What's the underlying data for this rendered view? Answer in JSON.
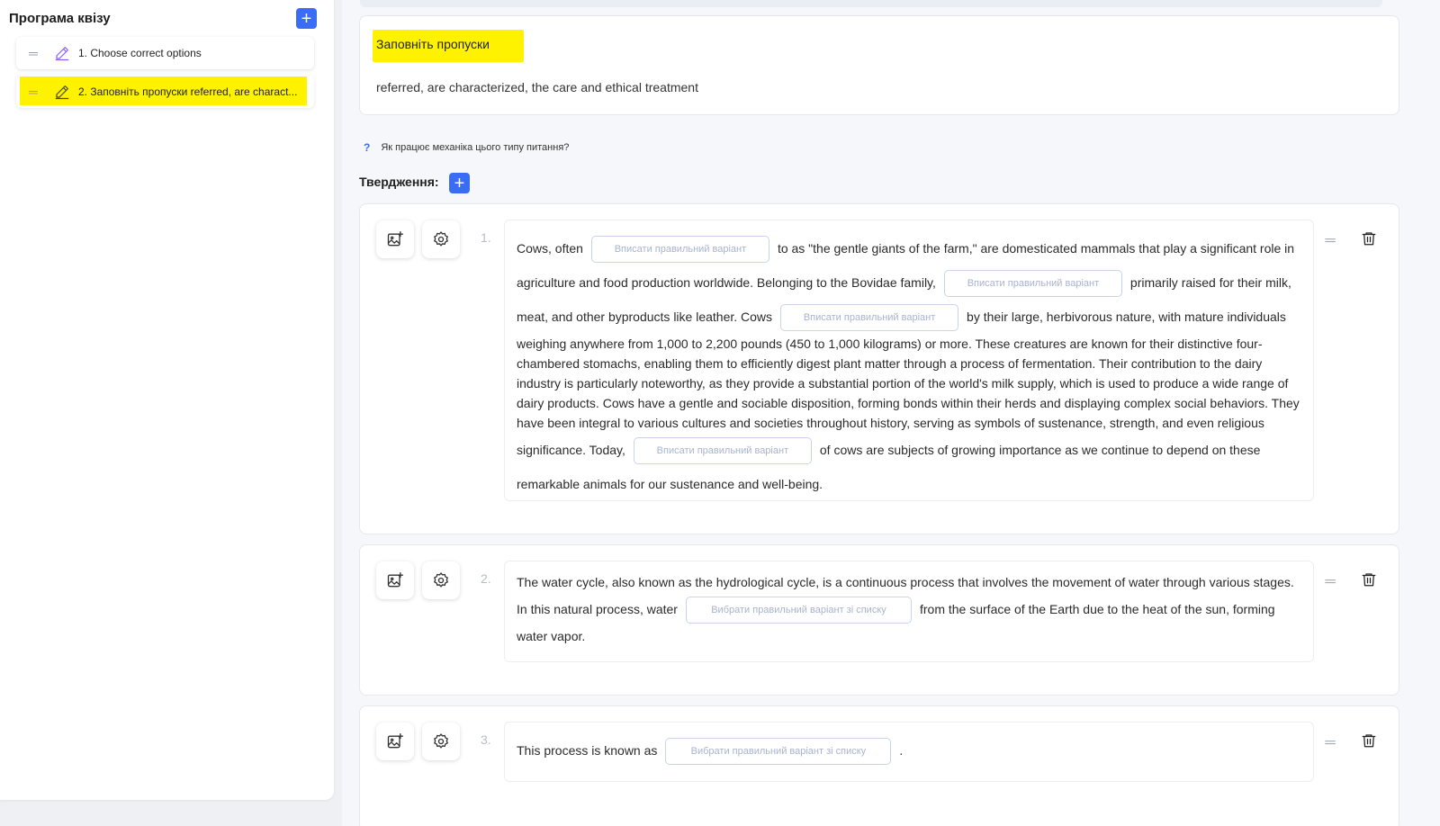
{
  "sidebar": {
    "title": "Програма квізу",
    "add_label": "+",
    "items": [
      {
        "label": "1. Choose correct options",
        "highlighted": false
      },
      {
        "label": "2. Заповніть пропуски referred, are charact...",
        "highlighted": true
      }
    ]
  },
  "question": {
    "title": "Заповніть пропуски",
    "answers": "referred, are characterized, the care and ethical treatment"
  },
  "help": {
    "icon": "?",
    "text": "Як працює механіка цього типу питання?"
  },
  "statements": {
    "heading": "Твердження:",
    "add_label": "+",
    "items": [
      {
        "number": "1.",
        "seg1": "Cows, often",
        "blank1": "Вписати правильний варіант",
        "seg2": "to as \"the gentle giants of the farm,\" are domesticated mammals that play a significant role in agriculture and food production worldwide. Belonging to the Bovidae family,",
        "blank2": "Вписати правильний варіант",
        "seg3": "primarily raised for their milk, meat, and other byproducts like leather. Cows",
        "blank3": "Вписати правильний варіант",
        "seg4": "by their large, herbivorous nature, with mature individuals weighing anywhere from 1,000 to 2,200 pounds (450 to 1,000 kilograms) or more. These creatures are known for their distinctive four-chambered stomachs, enabling them to efficiently digest plant matter through a process of fermentation. Their contribution to the dairy industry is particularly noteworthy, as they provide a substantial portion of the world's milk supply, which is used to produce a wide range of dairy products. Cows have a gentle and sociable disposition, forming bonds within their herds and displaying complex social behaviors. They have been integral to various cultures and societies throughout history, serving as symbols of sustenance, strength, and even religious significance. Today,",
        "blank4": "Вписати правильний варіант",
        "seg5": "of cows are subjects of growing importance as we continue to depend on these remarkable animals for our sustenance and well-being."
      },
      {
        "number": "2.",
        "seg1": "The water cycle, also known as the hydrological cycle, is a continuous process that involves the movement of water through various stages. In this natural process, water",
        "blank1": "Вибрати правильний варіант зі списку",
        "seg2": "from the surface of the Earth due to the heat of the sun, forming water vapor."
      },
      {
        "number": "3.",
        "seg1": "This process is known as",
        "blank1": "Вибрати правильний варіант зі списку",
        "seg2": "."
      }
    ]
  },
  "colors": {
    "accent": "#3b6cf5",
    "highlight": "#fff200"
  }
}
